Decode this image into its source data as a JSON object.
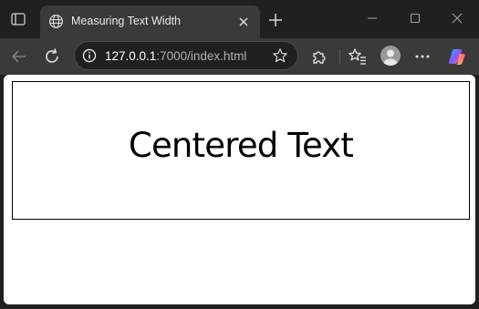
{
  "tab": {
    "title": "Measuring Text Width"
  },
  "address_bar": {
    "host": "127.0.0.1",
    "rest": ":7000/index.html"
  },
  "page": {
    "heading": "Centered Text"
  },
  "icons": {
    "window_menu": "window-icon",
    "tab_favicon": "globe-icon",
    "tab_close": "close-icon",
    "new_tab": "plus-icon",
    "minimize": "minimize-icon",
    "maximize": "maximize-icon",
    "close_window": "close-icon",
    "back": "back-arrow-icon",
    "refresh": "refresh-icon",
    "site_info": "info-icon",
    "favorite": "star-icon",
    "extensions": "puzzle-icon",
    "favorites": "favorites-icon",
    "profile": "avatar",
    "more": "more-icon",
    "copilot": "copilot-icon"
  },
  "colors": {
    "chrome": "#202020",
    "toolbar": "#3a3a3a",
    "page_bg": "#ffffff"
  }
}
